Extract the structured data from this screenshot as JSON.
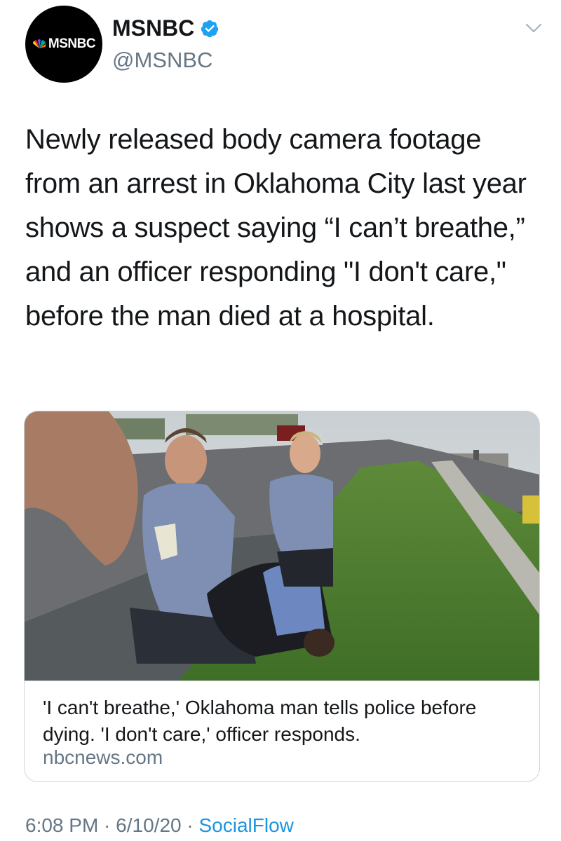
{
  "author": {
    "display_name": "MSNBC",
    "handle": "@MSNBC",
    "avatar_text": "MSNBC",
    "verified": true
  },
  "tweet": {
    "text": "Newly released body camera footage from an arrest in Oklahoma City last year shows a suspect saying “I can’t breathe,” and an officer responding \"I don't care,\" before the man died at a hospital."
  },
  "card": {
    "title": "'I can't breathe,' Oklahoma man tells police before dying. 'I don't care,' officer responds.",
    "domain": "nbcnews.com"
  },
  "footer": {
    "time": "6:08 PM",
    "separator_1": " · ",
    "date": "6/10/20",
    "separator_2": " · ",
    "source": "SocialFlow"
  },
  "colors": {
    "text_primary": "#14171a",
    "text_secondary": "#657786",
    "link": "#1b95e0",
    "verified": "#1da1f2",
    "border": "#ccd6dd"
  },
  "icons": {
    "verified": "verified-badge-icon",
    "caret": "chevron-down-icon",
    "logo": "nbc-peacock-icon"
  }
}
